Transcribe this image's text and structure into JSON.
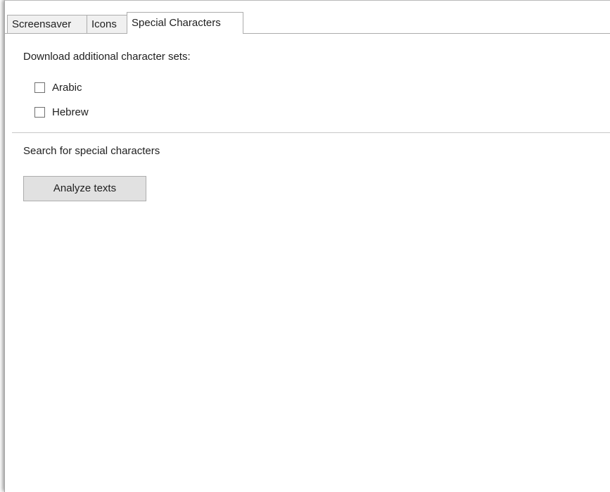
{
  "tabs": [
    {
      "label": "Screensaver",
      "active": false
    },
    {
      "label": "Icons",
      "active": false
    },
    {
      "label": "Special Characters",
      "active": true
    }
  ],
  "download_section": {
    "heading": "Download additional character sets:",
    "options": [
      {
        "label": "Arabic",
        "checked": false
      },
      {
        "label": "Hebrew",
        "checked": false
      }
    ]
  },
  "search_section": {
    "heading": "Search for special characters",
    "button_label": "Analyze texts"
  }
}
